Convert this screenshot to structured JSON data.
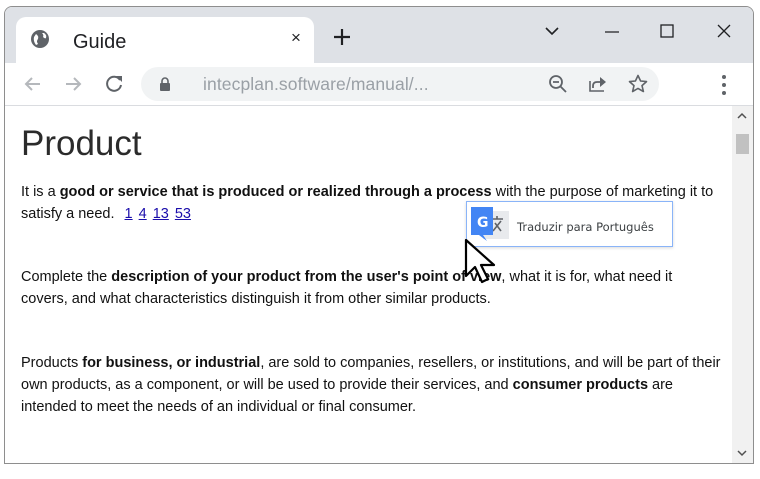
{
  "window": {
    "tab": {
      "title": "Guide",
      "favicon": "globe-icon",
      "close": "×"
    },
    "new_tab_icon": "plus-icon",
    "controls": [
      "chevron-down-icon",
      "minimize-icon",
      "maximize-icon",
      "close-icon"
    ]
  },
  "toolbar": {
    "url": "intecplan.software/manual/...",
    "icons": [
      "back-arrow-icon",
      "forward-arrow-icon",
      "reload-icon",
      "lock-icon",
      "zoom-out-icon",
      "share-icon",
      "star-icon",
      "kebab-menu-icon"
    ]
  },
  "page": {
    "title": "Product",
    "p1": {
      "t1": "It is a ",
      "b1": "good or service that is produced or realized through a process",
      "t2": " with the purpose of marketing it to satisfy a need.",
      "links": [
        "1",
        "4",
        "13",
        "53"
      ]
    },
    "p2": {
      "t1": "Complete the ",
      "b1": "description of your product from the user's point of view",
      "t2": ", what it is for, what need it covers, and what characteristics distinguish it from other similar products."
    },
    "p3": {
      "t1": "Products ",
      "b1": "for business, or industrial",
      "t2": ", are sold to companies, resellers, or institutions, and will be part of their own products, as a component, or will be used to provide their services, and ",
      "b2": "consumer products",
      "t3": " are intended to meet the needs of an individual or final consumer."
    }
  },
  "translate_popup": {
    "label": "Traduzir para Português",
    "icon": "google-translate-icon"
  },
  "colors": {
    "tabstrip": "#dee1e6",
    "omnibox": "#f1f3f4",
    "link": "#1a0dab",
    "translate_blue": "#4285f4"
  }
}
